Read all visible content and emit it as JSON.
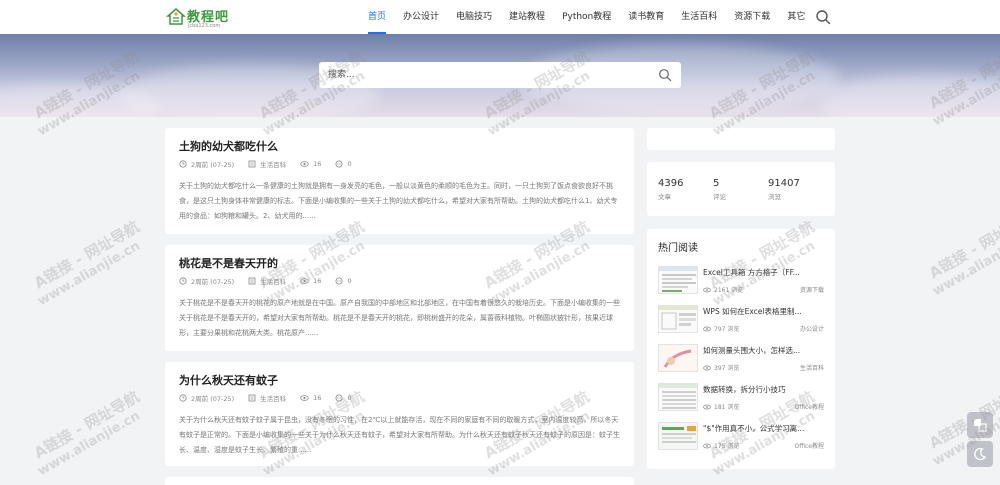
{
  "header": {
    "logo_text": "教程吧",
    "logo_sub": "jcba123.com",
    "nav": [
      {
        "label": "首页",
        "active": true
      },
      {
        "label": "办公设计"
      },
      {
        "label": "电脑技巧"
      },
      {
        "label": "建站教程"
      },
      {
        "label": "Python教程"
      },
      {
        "label": "读书教育"
      },
      {
        "label": "生活百科"
      },
      {
        "label": "资源下载"
      },
      {
        "label": "其它"
      }
    ],
    "search_icon": "search-icon"
  },
  "banner": {
    "search_placeholder": "搜索..."
  },
  "articles": [
    {
      "title": "土狗的幼犬都吃什么",
      "time": "2周前 (07-25)",
      "category": "生活百科",
      "views": "16",
      "comments": "0",
      "excerpt": "关于土狗的幼犬都吃什么一条健康的土狗就是拥有一身发亮的毛色，一般以淡黄色的柔顺的毛色为主。同时，一只土狗到了饭点食欲良好不挑食，是这只土狗身体非常健康的标志。下面是小编收集的一些关于土狗的幼犬都吃什么，希望对大家有所帮助。土狗的幼犬都吃什么1、幼犬专用的食品：如狗粮和罐头。2、幼犬用的......"
    },
    {
      "title": "桃花是不是春天开的",
      "time": "2周前 (07-25)",
      "category": "生活百科",
      "views": "16",
      "comments": "0",
      "excerpt": "关于桃花是不是春天开的桃花的原产地就是在中国。原产自我国的中部地区和北部地区，在中国有着很悠久的栽培历史。下面是小编收集的一些关于桃花是不是春天开的，希望对大家有所帮助。桃花是不是春天开的桃花，即桃树盛开的花朵，属蔷薇科植物。叶椭圆状披针形，核果近球形，主要分果桃和花桃两大类。桃花原产......"
    },
    {
      "title": "为什么秋天还有蚊子",
      "time": "2周前 (07-25)",
      "category": "生活百科",
      "views": "16",
      "comments": "0",
      "excerpt": "关于为什么秋天还有蚊子蚊子属于昆虫，没有冬眠的习性，在2℃以上就能存活，现在不同的家庭有不同的取暖方式，室内温度较高，所以冬天有蚊子是正常的。下面是小编收集的一些关于为什么秋天还有蚊子，希望对大家有所帮助。为什么秋天还有蚊子秋天还有蚊子的原因是：蚊子生长、温度、湿度是蚊子生长、繁殖的重......"
    }
  ],
  "stats": [
    {
      "num": "4396",
      "label": "文章"
    },
    {
      "num": "5",
      "label": "评论"
    },
    {
      "num": "91407",
      "label": "浏览"
    }
  ],
  "hot": {
    "title": "热门阅读",
    "items": [
      {
        "name": "Excel工具箱 方方格子（FF...",
        "views": "2161 浏览",
        "category": "资源下载"
      },
      {
        "name": "WPS 如何在Excel表格里制...",
        "views": "797 浏览",
        "category": "办公设计"
      },
      {
        "name": "如何测量头围大小，怎样选...",
        "views": "397 浏览",
        "category": "生活百科"
      },
      {
        "name": "数据转换，拆分行小技巧",
        "views": "181 浏览",
        "category": "Office教程"
      },
      {
        "name": "\"$\"作用真不小，公式学习离...",
        "views": "175 浏览",
        "category": "Office教程"
      }
    ]
  },
  "watermark": {
    "line1": "A链接 - 网址导航",
    "line2": "www.alianjie.cn"
  },
  "colors": {
    "accent": "#1e6fff",
    "logo_green": "#3a9b3c"
  }
}
